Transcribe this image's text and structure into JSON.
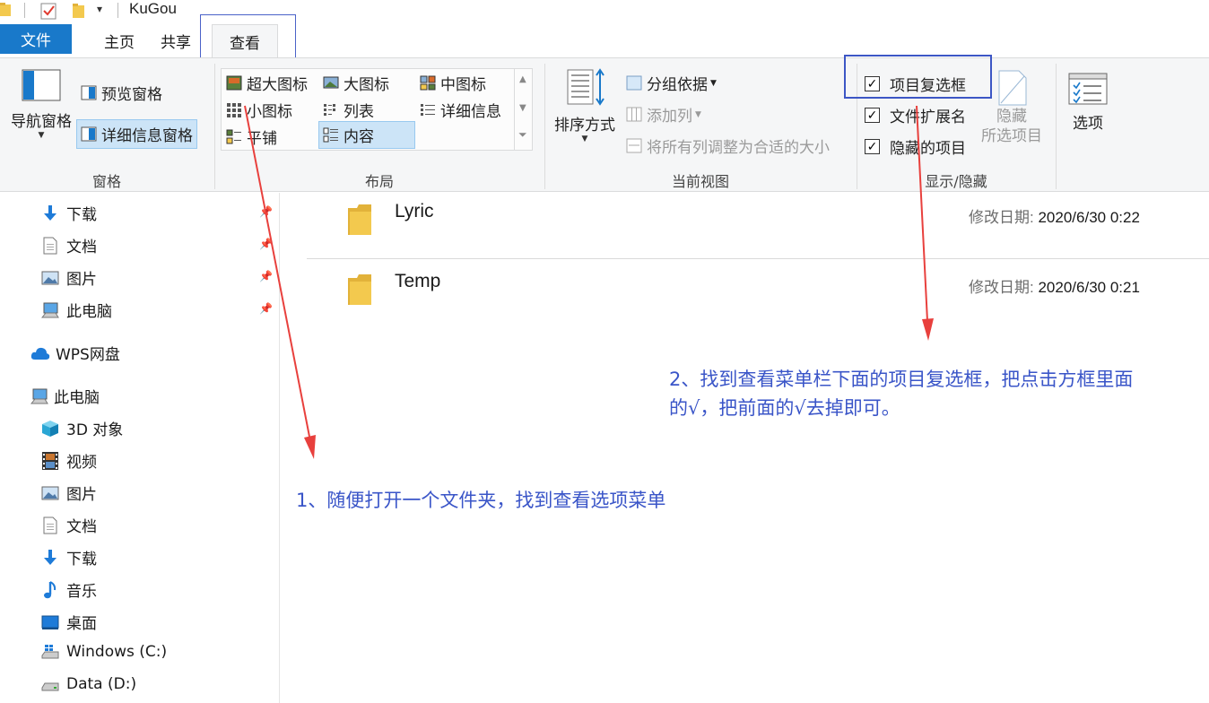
{
  "title_bar": {
    "window_title": "KuGou",
    "dropdown_glyph": "▾"
  },
  "tabs": [
    {
      "label": "文件"
    },
    {
      "label": "主页"
    },
    {
      "label": "共享"
    },
    {
      "label": "查看"
    }
  ],
  "ribbon": {
    "pane": {
      "nav_pane": "导航窗格",
      "preview_pane": "预览窗格",
      "details_pane": "详细信息窗格",
      "group_label": "窗格"
    },
    "layout": {
      "extra_large_icons": "超大图标",
      "large_icons": "大图标",
      "medium_icons": "中图标",
      "small_icons": "小图标",
      "list": "列表",
      "details": "详细信息",
      "tiles": "平铺",
      "content": "内容",
      "group_label": "布局"
    },
    "current_view": {
      "sort_by": "排序方式",
      "group_by": "分组依据",
      "add_columns": "添加列",
      "size_all_columns": "将所有列调整为合适的大小",
      "group_label": "当前视图"
    },
    "show_hide": {
      "item_checkboxes": "项目复选框",
      "file_name_extensions": "文件扩展名",
      "hidden_items": "隐藏的项目",
      "hide_selected_line1": "隐藏",
      "hide_selected_line2": "所选项目",
      "group_label": "显示/隐藏",
      "check_glyph": "✓"
    },
    "options": {
      "label": "选项"
    }
  },
  "nav": {
    "quick_access": [
      {
        "label": "下载",
        "icon": "download-arrow-icon"
      },
      {
        "label": "文档",
        "icon": "document-icon"
      },
      {
        "label": "图片",
        "icon": "picture-icon"
      },
      {
        "label": "此电脑",
        "icon": "computer-icon"
      }
    ],
    "wps": {
      "label": "WPS网盘",
      "icon": "cloud-icon"
    },
    "this_pc": {
      "label": "此电脑",
      "icon": "computer-icon"
    },
    "pc_items": [
      {
        "label": "3D 对象",
        "icon": "cube-3d-icon"
      },
      {
        "label": "视频",
        "icon": "video-film-icon"
      },
      {
        "label": "图片",
        "icon": "picture-icon"
      },
      {
        "label": "文档",
        "icon": "document-icon"
      },
      {
        "label": "下载",
        "icon": "download-arrow-icon"
      },
      {
        "label": "音乐",
        "icon": "music-note-icon"
      },
      {
        "label": "桌面",
        "icon": "desktop-icon"
      },
      {
        "label": "Windows (C:)",
        "icon": "windows-drive-icon"
      },
      {
        "label": "Data (D:)",
        "icon": "drive-icon"
      }
    ]
  },
  "files": [
    {
      "name": "Lyric",
      "date_label": "修改日期:",
      "date": "2020/6/30 0:22"
    },
    {
      "name": "Temp",
      "date_label": "修改日期:",
      "date": "2020/6/30 0:21"
    }
  ],
  "annotations": {
    "step2_line1": "2、找到查看菜单栏下面的项目复选框，把点击方框里面",
    "step2_line2": "的√，把前面的√去掉即可。",
    "step1": "1、随便打开一个文件夹，找到查看选项菜单"
  },
  "colors": {
    "file_tab_bg": "#1979ca",
    "annotation_text": "#3a55c8",
    "annotation_arrow": "#e8403d",
    "folder_yellow": "#f3c94e"
  }
}
